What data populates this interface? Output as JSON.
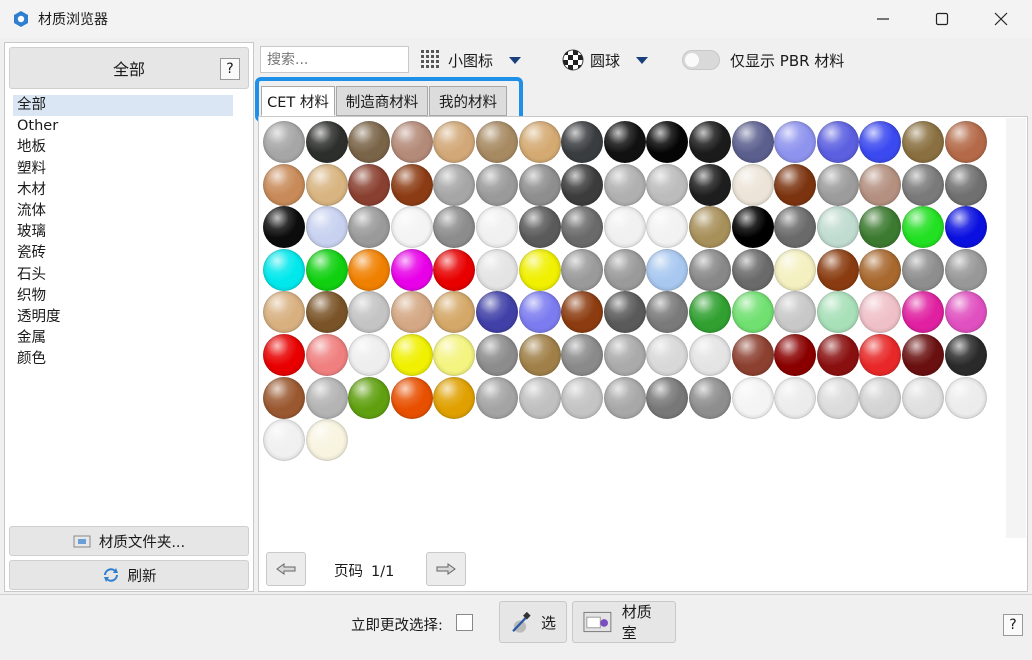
{
  "window": {
    "title": "材质浏览器"
  },
  "sidebar": {
    "all_button": "全部",
    "help": "?",
    "categories": [
      "全部",
      "Other",
      "地板",
      "塑料",
      "木材",
      "流体",
      "玻璃",
      "瓷砖",
      "石头",
      "织物",
      "透明度",
      "金属",
      "颜色"
    ],
    "selected_category": "全部",
    "folder_button": "材质文件夹...",
    "refresh_button": "刷新"
  },
  "toolbar": {
    "search_placeholder": "搜索...",
    "icon_size_label": "小图标",
    "shape_label": "圆球",
    "pbr_toggle_label": "仅显示 PBR 材料",
    "pbr_toggle_on": false
  },
  "tabs": [
    {
      "label": "CET 材料",
      "active": true
    },
    {
      "label": "制造商材料",
      "active": false
    },
    {
      "label": "我的材料",
      "active": false
    }
  ],
  "materials": [
    [
      "#a6a6a6",
      "#2d2f2c",
      "#7a6448",
      "#b48a78",
      "#d2a878",
      "#a78a62",
      "#d4aa72",
      "#3a3d40",
      "#111111",
      "#050505",
      "#1b1b1b",
      "#5b5f8e",
      "#8e93ee",
      "#5b5fe0",
      "#3b49f0",
      "#8a7040",
      "#b46a48"
    ],
    [
      "#c88a58",
      "#d8b480",
      "#8a4030",
      "#8c3c14",
      "#a6a6a6",
      "#9a9a9a",
      "#8e8e8e",
      "#3c3c3c",
      "#b0b0b0",
      "#bcbcbc",
      "#1e1e1e",
      "#ece4d8",
      "#7c3410",
      "#9c9c9c",
      "#b49080",
      "#7a7a7a",
      "#707070"
    ],
    [
      "#0c0c0c",
      "#c8d2f0",
      "#9a9a9a",
      "#f4f4f4",
      "#8c8c8c",
      "#f0f0f0",
      "#5a5a5a",
      "#6a6a6a",
      "#f0f0f0",
      "#f2f2f2",
      "#a8905a",
      "#000000",
      "#6a6a6a",
      "#c0dcd0",
      "#3c7a30",
      "#22e022",
      "#0a10e0"
    ],
    [
      "#00e8ec",
      "#10d010",
      "#f08000",
      "#e800e8",
      "#e80000",
      "#e4e4e4",
      "#f0f000",
      "#9a9a9a",
      "#9a9a9a",
      "#a8c8f0",
      "#888888",
      "#6a6a6a",
      "#f4f0c0",
      "#8a3c10",
      "#a8682e",
      "#8e8e8e",
      "#989898"
    ],
    [
      "#d8b080",
      "#7a5428",
      "#c4c4c4",
      "#d4a884",
      "#d4a868",
      "#4040a8",
      "#7c7cf0",
      "#8c3c10",
      "#5a5a5a",
      "#7a7a7a",
      "#30a030",
      "#70e070",
      "#c8c8c8",
      "#a8e0b8",
      "#f0c0c8",
      "#e020a0",
      "#e050c0"
    ],
    [
      "#e80000",
      "#f08080",
      "#eeeeee",
      "#f0f000",
      "#f4f480",
      "#8c8c8c",
      "#a08048",
      "#8a8a8a",
      "#aaaaaa",
      "#d8d8d8",
      "#e4e4e4",
      "#8c4030",
      "#8a0000",
      "#8a1010",
      "#e82828",
      "#6a1010",
      "#2a2a2a"
    ],
    [
      "#9a5830",
      "#b4b4b4",
      "#60a010",
      "#e85000",
      "#e0a000",
      "#a4a4a4",
      "#c0c0c0",
      "#c4c4c4",
      "#a8a8a8",
      "#787878",
      "#8e8e8e",
      "#f4f4f4",
      "#ececec",
      "#dcdcdc",
      "#d4d4d4",
      "#e0e0e0",
      "#ececec"
    ],
    [
      "#f0f0f0",
      "#f8f4e0"
    ]
  ],
  "pager": {
    "label": "页码",
    "value": "1/1"
  },
  "bottom": {
    "immediate_label": "立即更改选择:",
    "select_button": "选",
    "studio_button": "材质室",
    "help": "?"
  },
  "colors": {
    "highlight_frame": "#1e90e8",
    "selected_category_bg": "#dbe6f4",
    "caret": "#1a3f7a"
  }
}
